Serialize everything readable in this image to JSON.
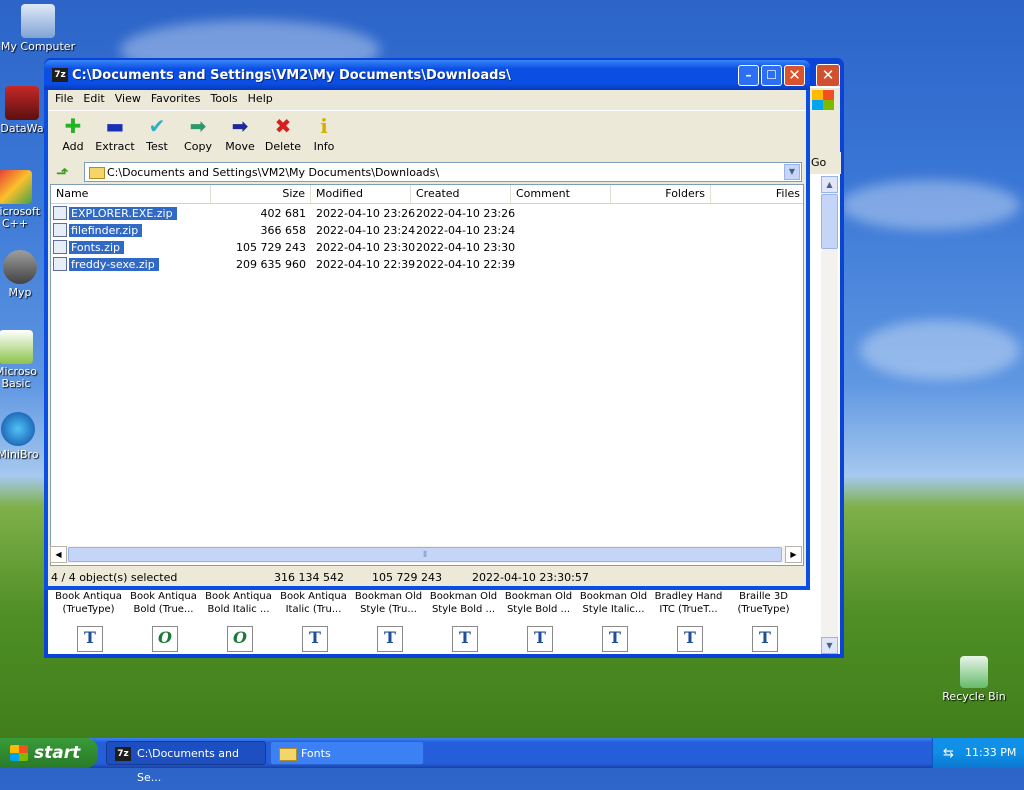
{
  "desktop": {
    "icons": [
      {
        "label": "My Computer"
      },
      {
        "label": "DataWa"
      },
      {
        "label": "Microsoft C++"
      },
      {
        "label": "Myp"
      },
      {
        "label": "Microso Basic"
      },
      {
        "label": "MiniBro"
      },
      {
        "label": "Recycle Bin"
      }
    ]
  },
  "back_window": {
    "go_label": "Go",
    "fonts": [
      {
        "line1": "Book Antiqua",
        "line2": "(TrueType)",
        "glyph": "T"
      },
      {
        "line1": "Book Antiqua",
        "line2": "Bold (True...",
        "glyph": "O"
      },
      {
        "line1": "Book Antiqua",
        "line2": "Bold Italic ...",
        "glyph": "O"
      },
      {
        "line1": "Book Antiqua",
        "line2": "Italic (Tru...",
        "glyph": "T"
      },
      {
        "line1": "Bookman Old",
        "line2": "Style (Tru...",
        "glyph": "T"
      },
      {
        "line1": "Bookman Old",
        "line2": "Style Bold ...",
        "glyph": "T"
      },
      {
        "line1": "Bookman Old",
        "line2": "Style Bold ...",
        "glyph": "T"
      },
      {
        "line1": "Bookman Old",
        "line2": "Style Italic...",
        "glyph": "T"
      },
      {
        "line1": "Bradley Hand",
        "line2": "ITC (TrueT...",
        "glyph": "T"
      },
      {
        "line1": "Braille 3D",
        "line2": "(TrueType)",
        "glyph": "T"
      }
    ]
  },
  "window": {
    "title": "C:\\Documents and Settings\\VM2\\My Documents\\Downloads\\",
    "icon_text": "7z",
    "menu": [
      "File",
      "Edit",
      "View",
      "Favorites",
      "Tools",
      "Help"
    ],
    "toolbar": [
      {
        "label": "Add",
        "icon": "plus-icon",
        "glyph": "✚",
        "color": "#22b422"
      },
      {
        "label": "Extract",
        "icon": "minus-icon",
        "glyph": "▬",
        "color": "#1a2fb8"
      },
      {
        "label": "Test",
        "icon": "check-icon",
        "glyph": "✔",
        "color": "#2ab0c8"
      },
      {
        "label": "Copy",
        "icon": "copy-arrow-icon",
        "glyph": "➡",
        "color": "#2a9a6a"
      },
      {
        "label": "Move",
        "icon": "move-arrow-icon",
        "glyph": "➡",
        "color": "#1a2a9a"
      },
      {
        "label": "Delete",
        "icon": "delete-x-icon",
        "glyph": "✖",
        "color": "#d81e1e"
      },
      {
        "label": "Info",
        "icon": "info-icon",
        "glyph": "i",
        "color": "#d4b000"
      }
    ],
    "address": "C:\\Documents and Settings\\VM2\\My Documents\\Downloads\\",
    "columns": [
      "Name",
      "Size",
      "Modified",
      "Created",
      "Comment",
      "Folders",
      "Files"
    ],
    "files": [
      {
        "name": "EXPLORER.EXE.zip",
        "size": "402 681",
        "modified": "2022-04-10 23:26",
        "created": "2022-04-10 23:26"
      },
      {
        "name": "filefinder.zip",
        "size": "366 658",
        "modified": "2022-04-10 23:24",
        "created": "2022-04-10 23:24"
      },
      {
        "name": "Fonts.zip",
        "size": "105 729 243",
        "modified": "2022-04-10 23:30",
        "created": "2022-04-10 23:30"
      },
      {
        "name": "freddy-sexe.zip",
        "size": "209 635 960",
        "modified": "2022-04-10 22:39",
        "created": "2022-04-10 22:39"
      }
    ],
    "status": {
      "selected": "4 / 4 object(s) selected",
      "total_size": "316 134 542",
      "selected_size": "105 729 243",
      "date": "2022-04-10 23:30:57"
    }
  },
  "taskbar": {
    "start_label": "start",
    "tasks": [
      {
        "label": "C:\\Documents and Se...",
        "icon_text": "7z"
      },
      {
        "label": "Fonts",
        "icon_text": ""
      }
    ],
    "clock": "11:33 PM"
  }
}
